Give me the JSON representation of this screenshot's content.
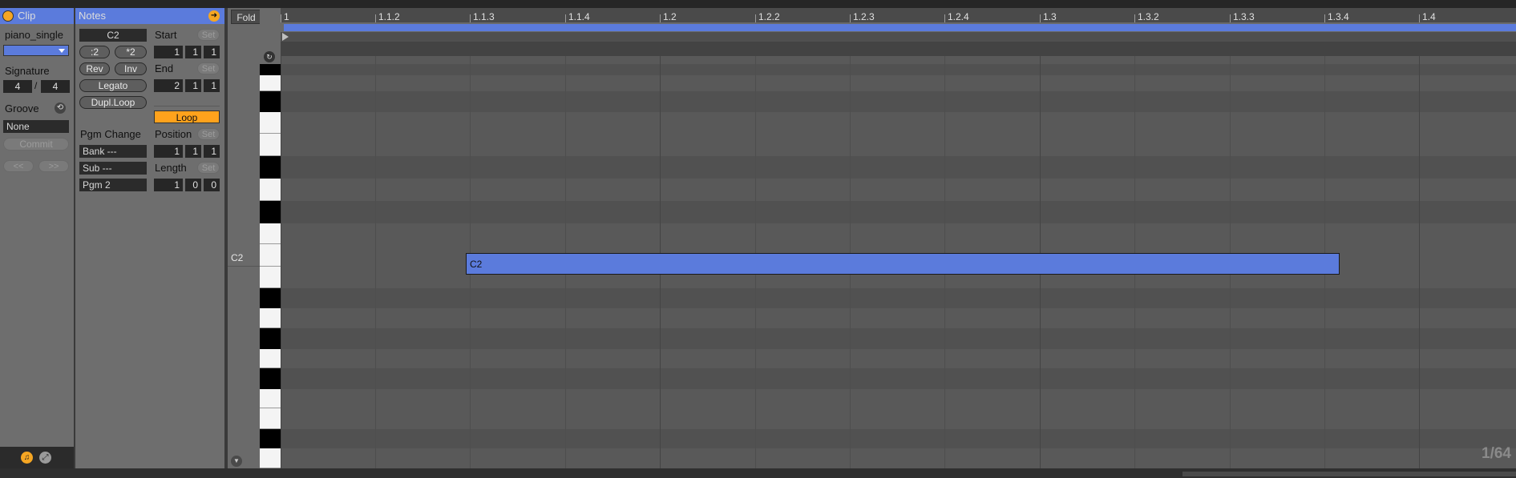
{
  "clip": {
    "title": "Clip",
    "name": "piano_single",
    "color": "#5b7bdc",
    "signature_label": "Signature",
    "sig_num": "4",
    "sig_sep": "/",
    "sig_den": "4",
    "groove_label": "Groove",
    "groove_value": "None",
    "commit_label": "Commit",
    "prev_label": "<<",
    "next_label": ">>"
  },
  "notes": {
    "title": "Notes",
    "pitch": "C2",
    "half_label": ":2",
    "double_label": "*2",
    "rev_label": "Rev",
    "inv_label": "Inv",
    "legato_label": "Legato",
    "dupl_label": "Dupl.Loop",
    "pgm_change_label": "Pgm Change",
    "bank_value": "Bank ---",
    "sub_value": "Sub ---",
    "pgm_value": "Pgm 2",
    "start_label": "Start",
    "end_label": "End",
    "position_label": "Position",
    "length_label": "Length",
    "set_label": "Set",
    "loop_label": "Loop",
    "start_values": [
      "1",
      "1",
      "1"
    ],
    "end_values": [
      "2",
      "1",
      "1"
    ],
    "position_values": [
      "1",
      "1",
      "1"
    ],
    "length_values": [
      "1",
      "0",
      "0"
    ]
  },
  "editor": {
    "fold_label": "Fold",
    "ruler_labels": [
      "1",
      "1.1.2",
      "1.1.3",
      "1.1.4",
      "1.2",
      "1.2.2",
      "1.2.3",
      "1.2.4",
      "1.3",
      "1.3.2",
      "1.3.3",
      "1.3.4",
      "1.4"
    ],
    "row_label": "C2",
    "note_label": "C2",
    "note_color": "#5b7bdc",
    "loop_brace_color": "#5b7bdc",
    "grid_quantization": "1/64"
  }
}
